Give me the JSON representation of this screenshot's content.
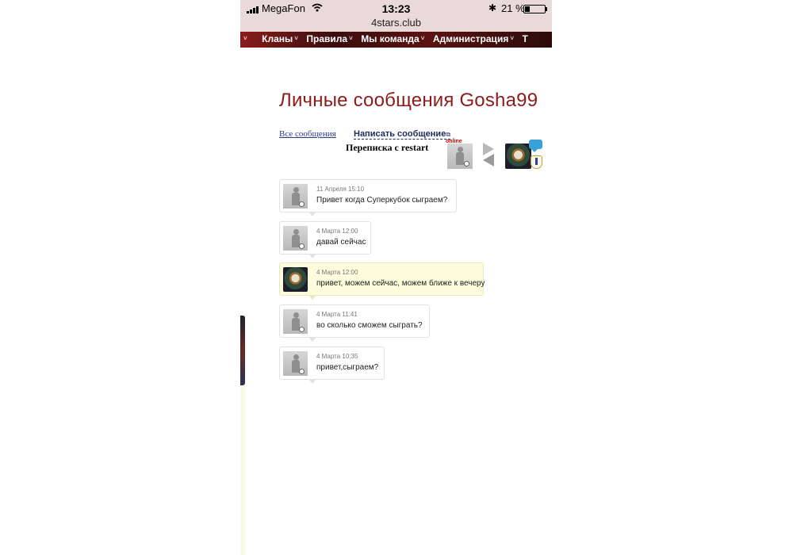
{
  "status_bar": {
    "carrier": "MegaFon",
    "time": "13:23",
    "url": "4stars.club",
    "battery": "21 %"
  },
  "nav": {
    "items": [
      "Кланы",
      "Правила",
      "Мы команда",
      "Администрация",
      "Т"
    ]
  },
  "page": {
    "title": "Личные сообщения Gosha99",
    "all_messages": "Все сообщения",
    "write_message": "Написать сообщение",
    "conversation_title": "Переписка с restart",
    "online_label": "online"
  },
  "messages": [
    {
      "time": "11 Апреля 15:10",
      "text": "Привет когда Суперкубок сыграем?",
      "mine": false
    },
    {
      "time": "4 Марта 12:00",
      "text": "давай сейчас",
      "mine": false
    },
    {
      "time": "4 Марта 12:00",
      "text": "привет, можем сейчас, можем ближе к вечеру",
      "mine": true
    },
    {
      "time": "4 Марта 11:41",
      "text": "во сколько сможем сыграть?",
      "mine": false
    },
    {
      "time": "4 Марта 10:35",
      "text": "привет,сыграем?",
      "mine": false
    }
  ],
  "colors": {
    "title": "#8e1b1b",
    "nav_bg": "#5b1212",
    "own_message_bg": "#fdfcdc",
    "link": "#2a3b85"
  }
}
